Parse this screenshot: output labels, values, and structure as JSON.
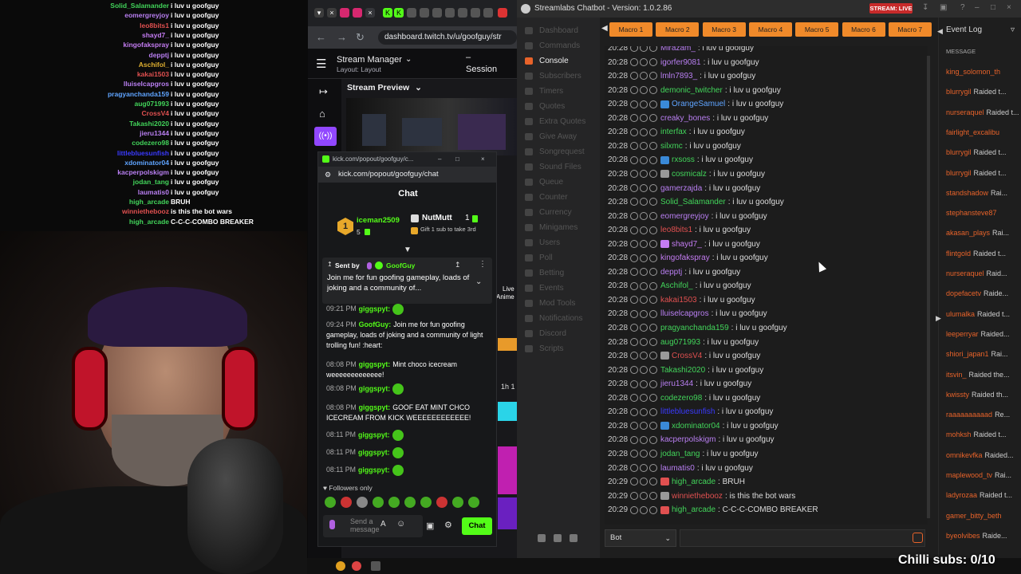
{
  "overlay_chat": [
    {
      "name": "Solid_Salamander",
      "msg": "i luv u goofguy",
      "color": "#42d45a"
    },
    {
      "name": "eomergreyjoy",
      "msg": "i luv u goofguy",
      "color": "#b97ff2"
    },
    {
      "name": "leo8bits1",
      "msg": "i luv u goofguy",
      "color": "#e05050"
    },
    {
      "name": "shayd7_",
      "msg": "i luv u goofguy",
      "color": "#c47cf2"
    },
    {
      "name": "kingofakspray",
      "msg": "i luv u goofguy",
      "color": "#c47cf2"
    },
    {
      "name": "depptj",
      "msg": "i luv u goofguy",
      "color": "#b97ff2"
    },
    {
      "name": "Aschifol_",
      "msg": "i luv u goofguy",
      "color": "#e0b030"
    },
    {
      "name": "kakai1503",
      "msg": "i luv u goofguy",
      "color": "#e05050"
    },
    {
      "name": "lluiselcapgros",
      "msg": "i luv u goofguy",
      "color": "#b97ff2"
    },
    {
      "name": "pragyanchanda159",
      "msg": "i luv u goofguy",
      "color": "#5fa4ff"
    },
    {
      "name": "aug071993",
      "msg": "i luv u goofguy",
      "color": "#42d45a"
    },
    {
      "name": "CrossV4",
      "msg": "i luv u goofguy",
      "color": "#e05050"
    },
    {
      "name": "Takashi2020",
      "msg": "i luv u goofguy",
      "color": "#42d45a"
    },
    {
      "name": "jieru1344",
      "msg": "i luv u goofguy",
      "color": "#b97ff2"
    },
    {
      "name": "codezero98",
      "msg": "i luv u goofguy",
      "color": "#42d45a"
    },
    {
      "name": "littlebluesunfish",
      "msg": "i luv u goofguy",
      "color": "#3a3aff"
    },
    {
      "name": "xdominator04",
      "msg": "i luv u goofguy",
      "color": "#5fa4ff"
    },
    {
      "name": "kacperpolskigm",
      "msg": "i luv u goofguy",
      "color": "#b97ff2"
    },
    {
      "name": "jodan_tang",
      "msg": "i luv u goofguy",
      "color": "#42d45a"
    },
    {
      "name": "laumatis0",
      "msg": "i luv u goofguy",
      "color": "#b97ff2"
    },
    {
      "name": "high_arcade",
      "msg": "BRUH",
      "color": "#42d45a"
    },
    {
      "name": "winniethebooz",
      "msg": "is this the bot wars",
      "color": "#e05050"
    },
    {
      "name": "high_arcade",
      "msg": "C-C-C-COMBO BREAKER",
      "color": "#42d45a"
    }
  ],
  "browser": {
    "url": "dashboard.twitch.tv/u/goofguy/str",
    "stream_manager": "Stream Manager",
    "layout": "Layout: Layout",
    "session_dash": "–",
    "session": "Session",
    "stream_preview": "Stream Preview",
    "preview_live": "Live",
    "preview_anime": "Anime",
    "preview_duration": "1h 1"
  },
  "kick": {
    "window_url": "kick.com/popout/goofguy/c...",
    "address": "kick.com/popout/goofguy/chat",
    "chat_title": "Chat",
    "top_gifter": {
      "rank": "1",
      "name": "iceman2509",
      "count": "5"
    },
    "second_user": {
      "name": "NutMutt",
      "count": "1",
      "hint": "Gift 1 sub to take 3rd"
    },
    "pinned": {
      "sent_by": "Sent by",
      "user": "GoofGuy",
      "text": "Join me for fun goofing gameplay, loads of joking and a community of..."
    },
    "messages": [
      {
        "time": "09:21 PM",
        "name": "giggspyt:",
        "text": ""
      },
      {
        "time": "09:24 PM",
        "name": "GoofGuy:",
        "text": "Join me for fun goofing gameplay, loads of joking and a community of light trolling fun! :heart:"
      },
      {
        "time": "08:08 PM",
        "name": "giggspyt:",
        "text": "Mint choco icecream weeeeeeeeeeeee!"
      },
      {
        "time": "08:08 PM",
        "name": "giggspyt:",
        "text": ""
      },
      {
        "time": "08:08 PM",
        "name": "giggspyt:",
        "text": "GOOF EAT MINT CHCO ICECREAM FROM KICK WEEEEEEEEEEEE!"
      },
      {
        "time": "08:11 PM",
        "name": "giggspyt:",
        "text": ""
      },
      {
        "time": "08:11 PM",
        "name": "giggspyt:",
        "text": ""
      },
      {
        "time": "08:11 PM",
        "name": "giggspyt:",
        "text": ""
      }
    ],
    "followers_only": "Followers only",
    "input_placeholder": "Send a message",
    "chat_button": "Chat"
  },
  "chatbot": {
    "title": "Streamlabs Chatbot - Version: 1.0.2.86",
    "stream_status": "STREAM: LIVE",
    "nav": [
      "Dashboard",
      "Commands",
      "Console",
      "Subscribers",
      "Timers",
      "Quotes",
      "Extra Quotes",
      "Give Away",
      "Songrequest",
      "Sound Files",
      "Queue",
      "Counter",
      "Currency",
      "Minigames",
      "Users",
      "Poll",
      "Betting",
      "Events",
      "Mod Tools",
      "Notifications",
      "Discord",
      "Scripts"
    ],
    "active_nav": "Console",
    "macros": [
      "Macro 1",
      "Macro 2",
      "Macro 3",
      "Macro 4",
      "Macro 5",
      "Macro 6",
      "Macro 7"
    ],
    "console": [
      {
        "time": "20:28",
        "name": "Mirazam_",
        "msg": ": i luv u goofguy",
        "color": "#b97ff2",
        "icon": ""
      },
      {
        "time": "20:28",
        "name": "igorfer9081",
        "msg": ": i luv u goofguy",
        "color": "#b97ff2",
        "icon": ""
      },
      {
        "time": "20:28",
        "name": "lmln7893_",
        "msg": ": i luv u goofguy",
        "color": "#b97ff2",
        "icon": ""
      },
      {
        "time": "20:28",
        "name": "demonic_twitcher",
        "msg": ": i luv u goofguy",
        "color": "#42d45a",
        "icon": ""
      },
      {
        "time": "20:28",
        "name": "OrangeSamuel",
        "msg": ": i luv u goofguy",
        "color": "#5fa4ff",
        "icon": "#3a8ad8"
      },
      {
        "time": "20:28",
        "name": "creaky_bones",
        "msg": ": i luv u goofguy",
        "color": "#b97ff2",
        "icon": ""
      },
      {
        "time": "20:28",
        "name": "interfax",
        "msg": ": i luv u goofguy",
        "color": "#42d45a",
        "icon": ""
      },
      {
        "time": "20:28",
        "name": "silxmc",
        "msg": ": i luv u goofguy",
        "color": "#42d45a",
        "icon": ""
      },
      {
        "time": "20:28",
        "name": "rxsoss",
        "msg": ": i luv u goofguy",
        "color": "#42d45a",
        "icon": "#3a8ad8"
      },
      {
        "time": "20:28",
        "name": "cosmicalz",
        "msg": ": i luv u goofguy",
        "color": "#42d45a",
        "icon": "#999999"
      },
      {
        "time": "20:28",
        "name": "gamerzajda",
        "msg": ": i luv u goofguy",
        "color": "#b97ff2",
        "icon": ""
      },
      {
        "time": "20:28",
        "name": "Solid_Salamander",
        "msg": ": i luv u goofguy",
        "color": "#42d45a",
        "icon": ""
      },
      {
        "time": "20:28",
        "name": "eomergreyjoy",
        "msg": ": i luv u goofguy",
        "color": "#b97ff2",
        "icon": ""
      },
      {
        "time": "20:28",
        "name": "leo8bits1",
        "msg": ": i luv u goofguy",
        "color": "#e05050",
        "icon": ""
      },
      {
        "time": "20:28",
        "name": "shayd7_",
        "msg": ": i luv u goofguy",
        "color": "#c47cf2",
        "icon": "#c47cf2"
      },
      {
        "time": "20:28",
        "name": "kingofakspray",
        "msg": ": i luv u goofguy",
        "color": "#c47cf2",
        "icon": ""
      },
      {
        "time": "20:28",
        "name": "depptj",
        "msg": ": i luv u goofguy",
        "color": "#b97ff2",
        "icon": ""
      },
      {
        "time": "20:28",
        "name": "Aschifol_",
        "msg": ": i luv u goofguy",
        "color": "#42d45a",
        "icon": ""
      },
      {
        "time": "20:28",
        "name": "kakai1503",
        "msg": ": i luv u goofguy",
        "color": "#e05050",
        "icon": ""
      },
      {
        "time": "20:28",
        "name": "lluiselcapgros",
        "msg": ": i luv u goofguy",
        "color": "#b97ff2",
        "icon": ""
      },
      {
        "time": "20:28",
        "name": "pragyanchanda159",
        "msg": ": i luv u goofguy",
        "color": "#42d45a",
        "icon": ""
      },
      {
        "time": "20:28",
        "name": "aug071993",
        "msg": ": i luv u goofguy",
        "color": "#42d45a",
        "icon": ""
      },
      {
        "time": "20:28",
        "name": "CrossV4",
        "msg": ": i luv u goofguy",
        "color": "#e05050",
        "icon": "#999999"
      },
      {
        "time": "20:28",
        "name": "Takashi2020",
        "msg": ": i luv u goofguy",
        "color": "#42d45a",
        "icon": ""
      },
      {
        "time": "20:28",
        "name": "jieru1344",
        "msg": ": i luv u goofguy",
        "color": "#b97ff2",
        "icon": ""
      },
      {
        "time": "20:28",
        "name": "codezero98",
        "msg": ": i luv u goofguy",
        "color": "#42d45a",
        "icon": ""
      },
      {
        "time": "20:28",
        "name": "littlebluesunfish",
        "msg": ": i luv u goofguy",
        "color": "#3a3aff",
        "icon": ""
      },
      {
        "time": "20:28",
        "name": "xdominator04",
        "msg": ": i luv u goofguy",
        "color": "#42d45a",
        "icon": "#3a8ad8"
      },
      {
        "time": "20:28",
        "name": "kacperpolskigm",
        "msg": ": i luv u goofguy",
        "color": "#b97ff2",
        "icon": ""
      },
      {
        "time": "20:28",
        "name": "jodan_tang",
        "msg": ": i luv u goofguy",
        "color": "#42d45a",
        "icon": ""
      },
      {
        "time": "20:28",
        "name": "laumatis0",
        "msg": ": i luv u goofguy",
        "color": "#b97ff2",
        "icon": ""
      },
      {
        "time": "20:29",
        "name": "high_arcade",
        "msg": ": BRUH",
        "color": "#42d45a",
        "icon": "#e05050"
      },
      {
        "time": "20:29",
        "name": "winniethebooz",
        "msg": ": is this the bot wars",
        "color": "#e05050",
        "icon": "#999999"
      },
      {
        "time": "20:29",
        "name": "high_arcade",
        "msg": ": C-C-C-COMBO BREAKER",
        "color": "#42d45a",
        "icon": "#e05050"
      }
    ],
    "bot_select": "Bot",
    "event_log_title": "Event Log",
    "event_log_col": "MESSAGE",
    "events": [
      {
        "name": "king_solomon_th",
        "txt": ""
      },
      {
        "name": "blurrygil",
        "txt": "Raided t..."
      },
      {
        "name": "nurseraquel",
        "txt": "Raided t..."
      },
      {
        "name": "fairlight_excalibu",
        "txt": ""
      },
      {
        "name": "blurrygil",
        "txt": "Raided t..."
      },
      {
        "name": "blurrygil",
        "txt": "Raided t..."
      },
      {
        "name": "standshadow",
        "txt": "Rai..."
      },
      {
        "name": "stephansteve87",
        "txt": ""
      },
      {
        "name": "akasan_plays",
        "txt": "Rai..."
      },
      {
        "name": "flintgold",
        "txt": "Raided t..."
      },
      {
        "name": "nurseraquel",
        "txt": "Raid..."
      },
      {
        "name": "dopefacetv",
        "txt": "Raide..."
      },
      {
        "name": "ulumalka",
        "txt": "Raided t..."
      },
      {
        "name": "leeperryar",
        "txt": "Raided..."
      },
      {
        "name": "shiori_japan1",
        "txt": "Rai..."
      },
      {
        "name": "itsvin_",
        "txt": "Raided the..."
      },
      {
        "name": "kwissty",
        "txt": "Raided th..."
      },
      {
        "name": "raaaaaaaaaad",
        "txt": "Re..."
      },
      {
        "name": "mohksh",
        "txt": "Raided t..."
      },
      {
        "name": "omnikevfka",
        "txt": "Raided..."
      },
      {
        "name": "maplewood_tv",
        "txt": "Rai..."
      },
      {
        "name": "ladyrozaa",
        "txt": "Raided t..."
      },
      {
        "name": "gamer_bitty_beth",
        "txt": ""
      },
      {
        "name": "byeolvibes",
        "txt": "Raide..."
      }
    ]
  },
  "chilli_subs": "Chilli subs: 0/10",
  "colors": {
    "accent": "#e8632a",
    "macro": "#f08a2a",
    "kick_green": "#53fc18",
    "live_red": "#c72a2a"
  }
}
